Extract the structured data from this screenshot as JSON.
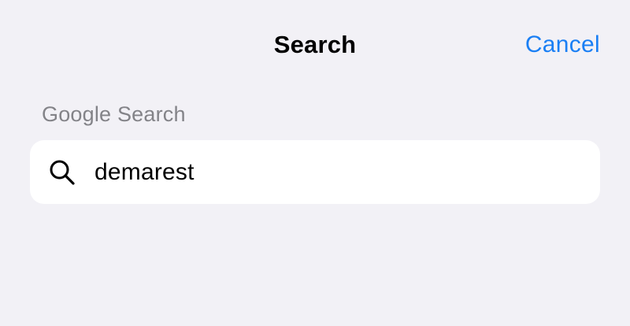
{
  "header": {
    "title": "Search",
    "cancel_label": "Cancel"
  },
  "section": {
    "header": "Google Search"
  },
  "search": {
    "value": "demarest",
    "icon": "magnifying-glass"
  },
  "colors": {
    "background": "#f2f1f6",
    "accent": "#1a7ff4",
    "secondary_text": "#838388",
    "field_background": "#ffffff"
  }
}
